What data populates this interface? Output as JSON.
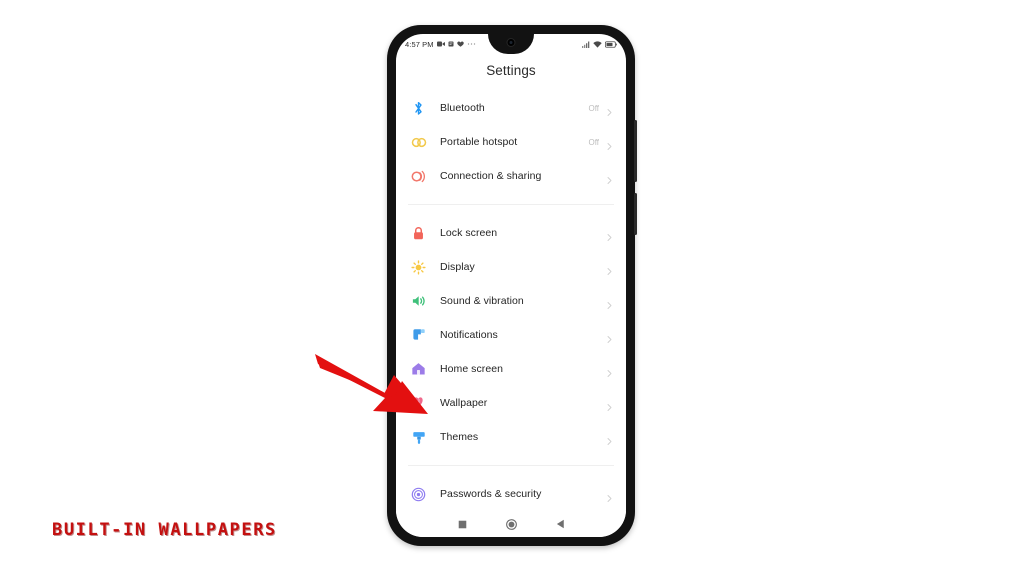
{
  "caption": "BUILT-IN  WALLPAPERS",
  "phone": {
    "status_bar": {
      "time": "4:57 PM",
      "left_icons": [
        "video-camera-icon",
        "calendar-icon",
        "face-icon",
        "more-dots-icon"
      ],
      "right_icons": [
        "signal-bars-icon",
        "wifi-icon",
        "battery-icon"
      ]
    },
    "screen_title": "Settings",
    "nav_bar": {
      "recents_label": "recents-square-icon",
      "home_label": "home-circle-icon",
      "back_label": "back-triangle-icon"
    }
  },
  "settings": {
    "groups": [
      {
        "items": [
          {
            "label": "Bluetooth",
            "value": "Off",
            "icon": "bluetooth-icon",
            "color": "#2196F3"
          },
          {
            "label": "Portable hotspot",
            "value": "Off",
            "icon": "hotspot-icon",
            "color": "#F2C94C"
          },
          {
            "label": "Connection & sharing",
            "value": "",
            "icon": "connection-sharing-icon",
            "color": "#F2776B"
          }
        ]
      },
      {
        "items": [
          {
            "label": "Lock screen",
            "value": "",
            "icon": "lock-icon",
            "color": "#F2655A"
          },
          {
            "label": "Display",
            "value": "",
            "icon": "brightness-sun-icon",
            "color": "#F7C843"
          },
          {
            "label": "Sound & vibration",
            "value": "",
            "icon": "speaker-icon",
            "color": "#3FC07A"
          },
          {
            "label": "Notifications",
            "value": "",
            "icon": "notifications-icon",
            "color": "#3E9BE9"
          },
          {
            "label": "Home screen",
            "value": "",
            "icon": "home-house-icon",
            "color": "#9C7CE8"
          },
          {
            "label": "Wallpaper",
            "value": "",
            "icon": "wallpaper-flower-icon",
            "color": "#F0698C"
          },
          {
            "label": "Themes",
            "value": "",
            "icon": "themes-brush-icon",
            "color": "#42A5F5"
          }
        ]
      },
      {
        "items": [
          {
            "label": "Passwords & security",
            "value": "",
            "icon": "fingerprint-icon",
            "color": "#8E7CF0"
          }
        ]
      }
    ]
  },
  "annotation": {
    "arrow_color": "#E31010",
    "arrow_target": "Wallpaper"
  }
}
